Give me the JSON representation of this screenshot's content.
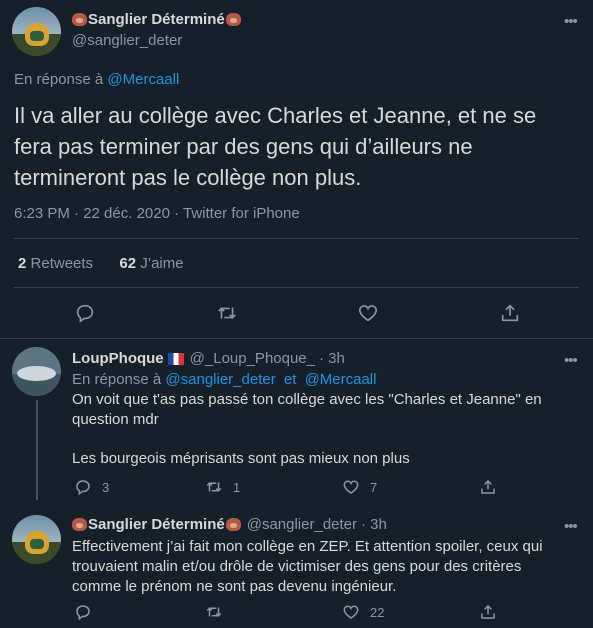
{
  "main_tweet": {
    "display_name": "Sanglier Déterminé",
    "handle": "@sanglier_deter",
    "reply_prefix": "En réponse à",
    "reply_to": "@Mercaall",
    "text": "Il va aller au collège avec Charles et Jeanne, et ne se fera pas terminer par des gens qui d’ailleurs ne termineront pas le collège non plus.",
    "meta": "6:23 PM · 22 déc. 2020 · Twitter for iPhone",
    "retweets_count": "2",
    "retweets_label": "Retweets",
    "likes_count": "62",
    "likes_label": "J’aime"
  },
  "replies": [
    {
      "display_name": "LoupPhoque",
      "handle": "@_Loup_Phoque_",
      "time": "· 3h",
      "reply_prefix": "En réponse à",
      "reply_to_1": "@sanglier_deter",
      "reply_and": "et",
      "reply_to_2": "@Mercaall",
      "text_1": "On voit que t'as pas passé ton collège avec les \"Charles et Jeanne\" en question mdr",
      "text_2": "Les bourgeois méprisants sont pas mieux non plus",
      "reply_count": "3",
      "retweet_count": "1",
      "like_count": "7"
    },
    {
      "display_name": "Sanglier Déterminé",
      "handle": "@sanglier_deter",
      "time": "· 3h",
      "text_1": "Effectivement j’ai fait mon collège en ZEP. Et attention spoiler, ceux qui trouvaient malin et/ou drôle de victimiser des gens pour des critères comme le prénom ne sont pas devenu ingénieur.",
      "like_count": "22"
    }
  ],
  "icons": {
    "more": "more-icon",
    "reply": "reply-icon",
    "retweet": "retweet-icon",
    "like": "heart-icon",
    "share": "share-icon"
  },
  "colors": {
    "background": "#15202b",
    "link": "#1b95e0",
    "muted": "#8899a6",
    "divider": "#38444d"
  }
}
